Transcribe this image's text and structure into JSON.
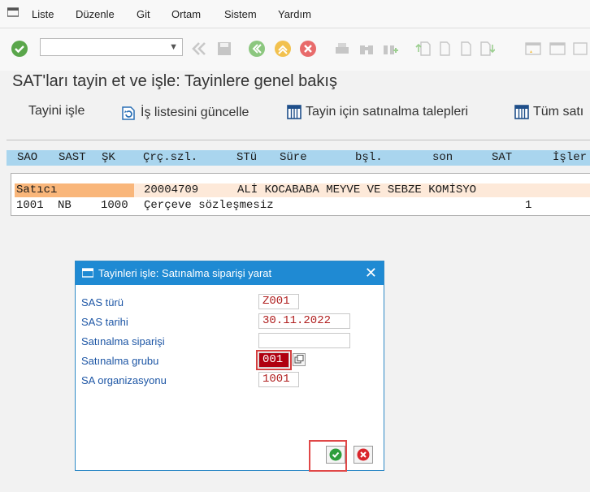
{
  "menu": {
    "items": [
      "Liste",
      "Düzenle",
      "Git",
      "Ortam",
      "Sistem",
      "Yardım"
    ]
  },
  "command_field": {
    "value": ""
  },
  "page_title": "SAT'ları tayin et ve işle: Tayinlere genel bakış",
  "app_toolbar": {
    "process": "Tayini işle",
    "refresh": "İş listesini güncelle",
    "requisitions": "Tayin için satınalma talepleri",
    "all": "Tüm satı"
  },
  "grid": {
    "headers": [
      "SAO",
      "SAST",
      "ŞK",
      "Çrç.szl.",
      "STü",
      "Süre",
      "bşl.",
      "son",
      "SAT",
      "İşler"
    ],
    "row1": {
      "label": "Satıcı",
      "vendor": "20004709",
      "name": "ALİ KOCABABA MEYVE VE SEBZE KOMİSYO"
    },
    "row2": {
      "sao": "1001",
      "sast": "NB",
      "sk": "1000",
      "contract": "Çerçeve sözleşmesiz",
      "sat": "1"
    }
  },
  "dialog": {
    "title": "Tayinleri işle: Satınalma siparişi yarat",
    "fields": {
      "sas_turu": {
        "label": "SAS türü",
        "value": "Z001"
      },
      "sas_tarihi": {
        "label": "SAS tarihi",
        "value": "30.11.2022"
      },
      "satinalma_siparisi": {
        "label": "Satınalma siparişi",
        "value": ""
      },
      "satinalma_grubu": {
        "label": "Satınalma grubu",
        "value": "001"
      },
      "sa_org": {
        "label": "SA organizasyonu",
        "value": "1001"
      }
    }
  },
  "colors": {
    "header_blue": "#1f8ad3",
    "accent_green": "#2e9e3b",
    "cancel_red": "#d9262c"
  }
}
